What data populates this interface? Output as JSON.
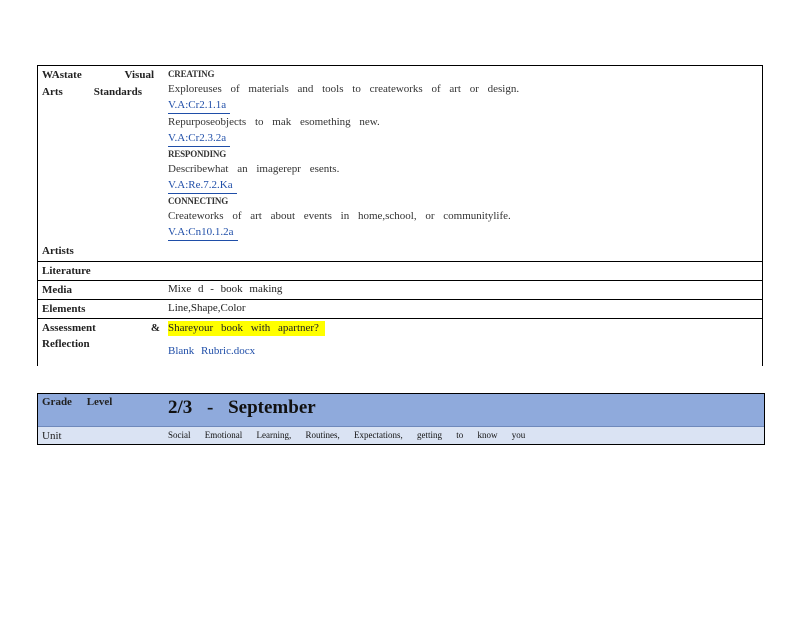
{
  "standards": {
    "label_line1_left": "WAstate",
    "label_line1_right": "Visual",
    "label_line2_left": "Arts",
    "label_line2_right": "Standards",
    "creating_heading": "CREATING",
    "creating_line1": "Exploreuses of materials and tools to createworks of art or design.",
    "creating_link1": "V.A:Cr2.1.1a",
    "creating_line2": "Repurposeobjects to mak esomething new.",
    "creating_link2": "V.A:Cr2.3.2a",
    "responding_heading": "RESPONDING",
    "responding_line1": "Describewhat an imagerepr esents.",
    "responding_link1": "V.A:Re.7.2.Ka",
    "connecting_heading": "CONNECTING",
    "connecting_line1": "Createworks of art about events in home,school, or communitylife.",
    "connecting_link1": "V.A:Cn10.1.2a"
  },
  "artists": {
    "label": "Artists"
  },
  "literature": {
    "label": "Literature"
  },
  "media": {
    "label": "Media",
    "value": "Mixe d - book making"
  },
  "elements": {
    "label": "Elements",
    "value": "Line,Shape,Color"
  },
  "assessment": {
    "label_left": "Assessment",
    "label_right": "&",
    "label_line2": "Reflection",
    "highlight": "Shareyour book with apartner?",
    "link": "Blank Rubric.docx"
  },
  "grade": {
    "label": "Grade Level",
    "value": "2/3 - September"
  },
  "unit": {
    "label": "Unit",
    "value": "Social Emotional Learning, Routines, Expectations, getting to know you"
  },
  "colors": {
    "link": "#1f4ea8",
    "highlight": "#ffff00",
    "grade_bg": "#8faadc",
    "unit_bg": "#dae3f3"
  }
}
